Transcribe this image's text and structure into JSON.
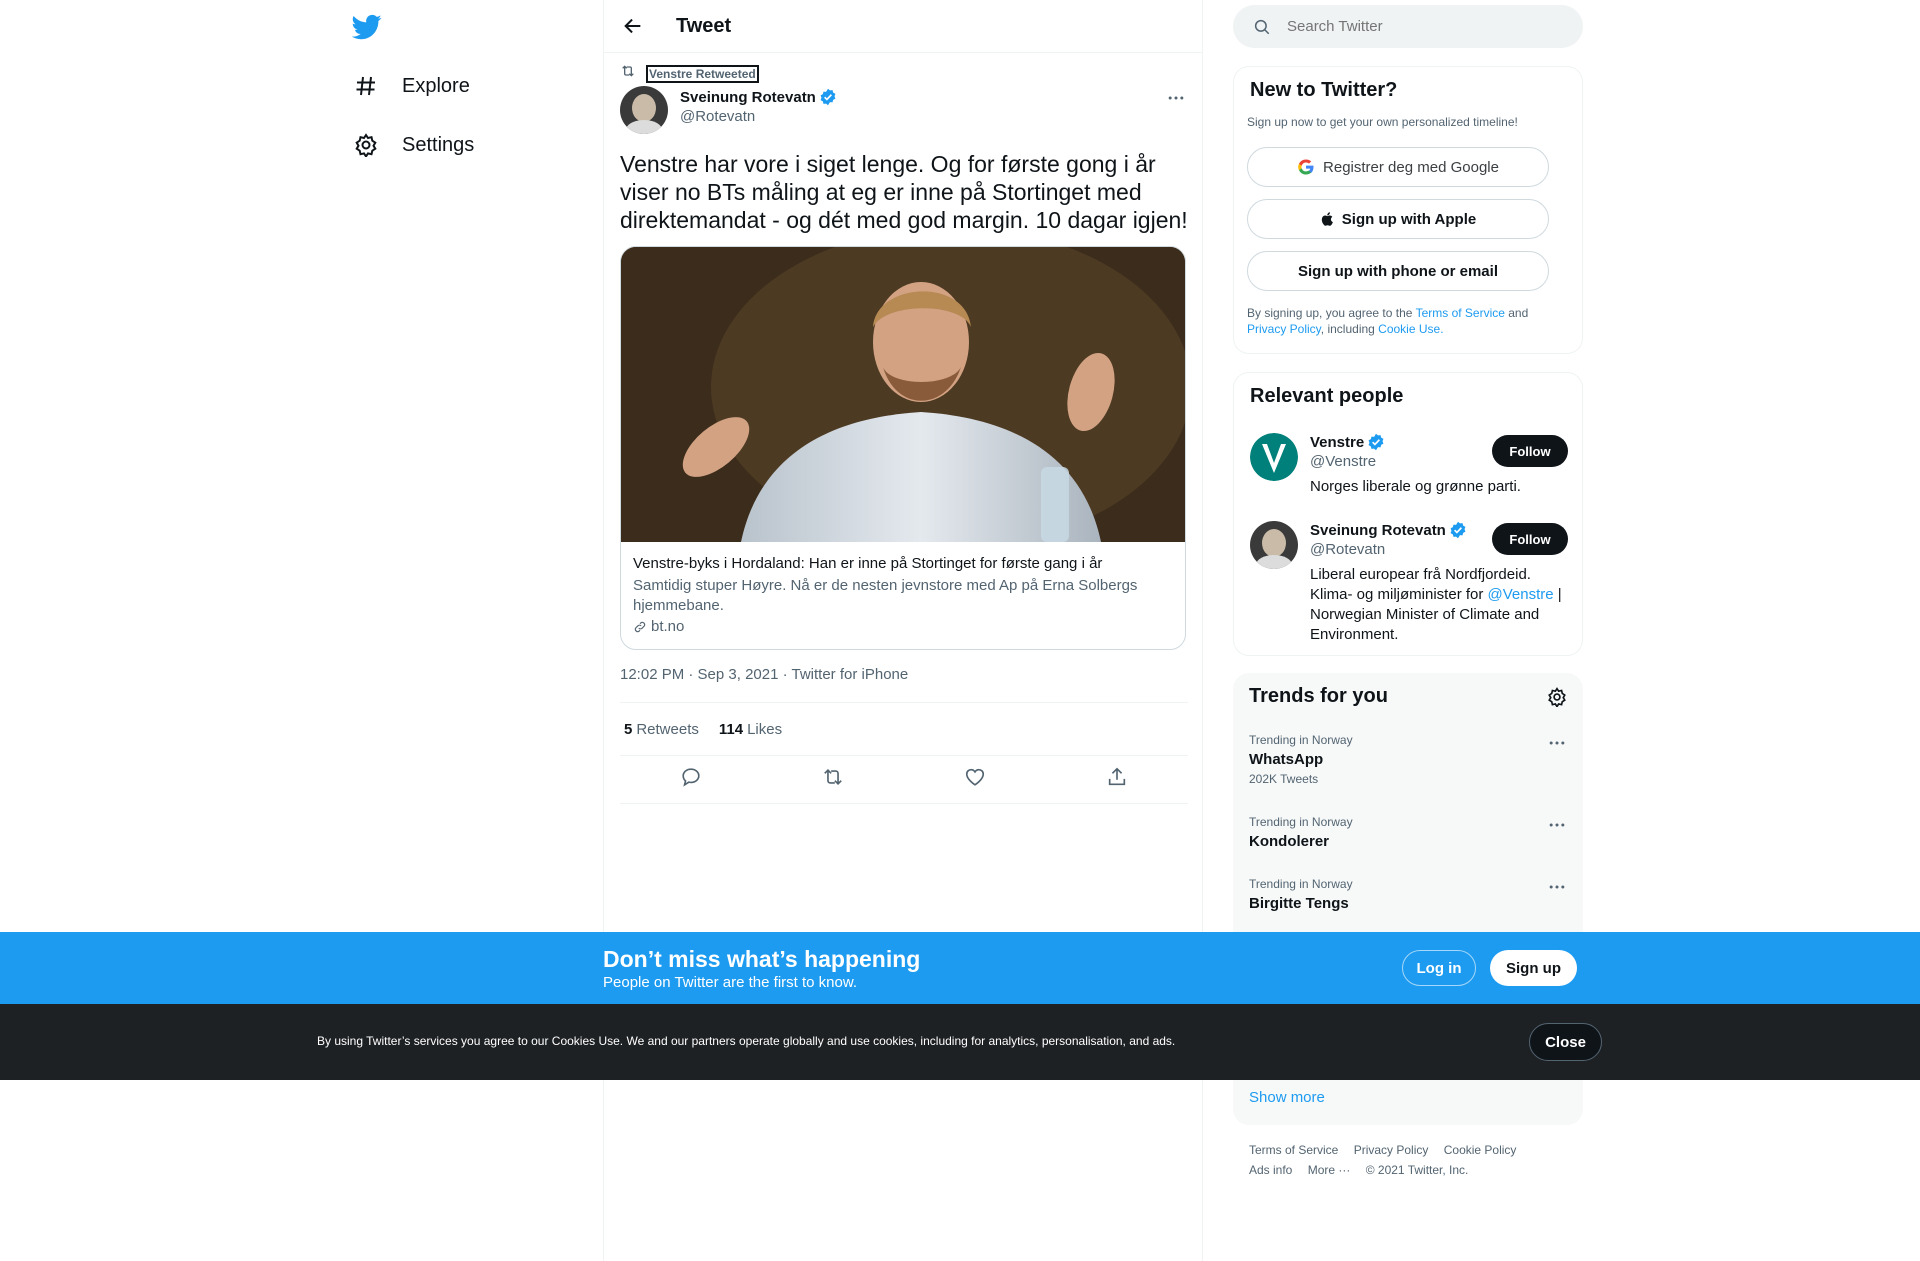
{
  "nav": {
    "logo": "twitter-bird-icon",
    "items": [
      {
        "label": "Explore",
        "icon": "hashtag-icon"
      },
      {
        "label": "Settings",
        "icon": "gear-icon"
      }
    ]
  },
  "header": {
    "title": "Tweet"
  },
  "tweet": {
    "retweeted_by": "Venstre Retweeted",
    "author_name": "Sveinung Rotevatn",
    "author_handle": "@Rotevatn",
    "text": "Venstre har vore i siget lenge. Og for første gong i år viser no BTs måling at eg er inne på Stortinget med direktemandat - og dét med god margin. 10 dagar igjen!",
    "card": {
      "title": "Venstre-byks i Hordaland: Han er inne på Stortinget for første gang i år",
      "description": "Samtidig stuper Høyre. Nå er de nesten jevnstore med Ap på Erna Solbergs hjemmebane.",
      "domain": "bt.no"
    },
    "meta": "12:02 PM · Sep 3, 2021 · Twitter for iPhone",
    "retweets_count": "5",
    "retweets_label": "Retweets",
    "likes_count": "114",
    "likes_label": "Likes"
  },
  "sidebar": {
    "search_placeholder": "Search Twitter",
    "signup": {
      "title": "New to Twitter?",
      "subtitle": "Sign up now to get your own personalized timeline!",
      "google": "Registrer deg med Google",
      "apple": "Sign up with Apple",
      "phone": "Sign up with phone or email",
      "legal_1": "By signing up, you agree to the ",
      "terms": "Terms of Service",
      "legal_and": " and",
      "privacy": "Privacy Policy",
      "legal_2": ", including ",
      "cookie": "Cookie Use."
    },
    "relevant": {
      "title": "Relevant people",
      "people": [
        {
          "name": "Venstre",
          "handle": "@Venstre",
          "bio": "Norges liberale og grønne parti.",
          "follow": "Follow"
        },
        {
          "name": "Sveinung Rotevatn",
          "handle": "@Rotevatn",
          "bio_1": "Liberal europear frå Nordfjordeid. Klima- og miljøminister for ",
          "bio_link": "@Venstre",
          "bio_2": " | Norwegian Minister of Climate and Environment.",
          "follow": "Follow"
        }
      ]
    },
    "trends": {
      "title": "Trends for you",
      "items": [
        {
          "context": "Trending in Norway",
          "name": "WhatsApp",
          "count": "202K Tweets"
        },
        {
          "context": "Trending in Norway",
          "name": "Kondolerer",
          "count": ""
        },
        {
          "context": "Trending in Norway",
          "name": "Birgitte Tengs",
          "count": ""
        }
      ],
      "show_more": "Show more"
    },
    "footer": {
      "links": [
        "Terms of Service",
        "Privacy Policy",
        "Cookie Policy"
      ],
      "links2": [
        "Ads info",
        "More ···",
        "© 2021 Twitter, Inc."
      ]
    }
  },
  "banner": {
    "title": "Don’t miss what’s happening",
    "subtitle": "People on Twitter are the first to know.",
    "login": "Log in",
    "signup": "Sign up"
  },
  "cookie": {
    "text": "By using Twitter’s services you agree to our Cookies Use. We and our partners operate globally and use cookies, including for analytics, personalisation, and ads.",
    "close": "Close"
  },
  "colors": {
    "accent": "#1d9bf0",
    "text": "#0f1419",
    "muted": "#536471",
    "cookie_bg": "#1e2124"
  }
}
